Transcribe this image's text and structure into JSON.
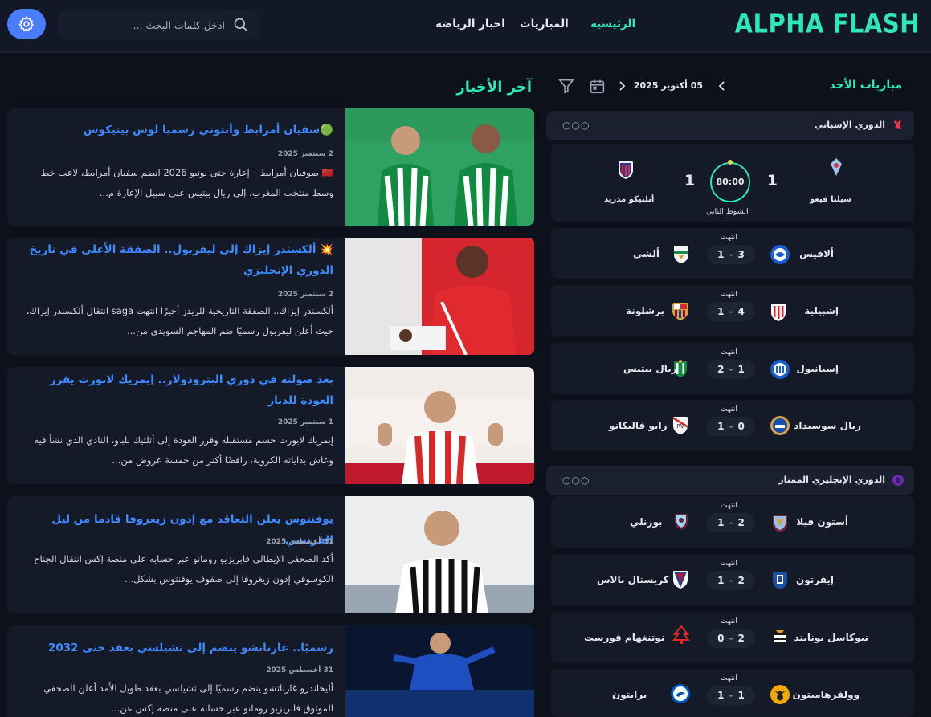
{
  "brand": {
    "logo_text": "ALPHA FLASH",
    "accent": "#2ee6b6",
    "link": "#3e8bff"
  },
  "nav": {
    "items": [
      {
        "label": "الرئيسية",
        "active": true
      },
      {
        "label": "المباريات",
        "active": false
      },
      {
        "label": "اخبار الرياضة",
        "active": false
      }
    ]
  },
  "search": {
    "placeholder": "ادخل كلمات البحث ..."
  },
  "icons": {
    "search": "search-icon",
    "settings": "gear-icon",
    "calendar": "calendar-icon",
    "filter": "filter-icon"
  },
  "matches": {
    "title": "مباريات الأحد",
    "date": "05 أكتوبر 2025",
    "leagues": [
      {
        "name": "الدوري الإسباني",
        "featured": {
          "home": "سيلتا فيغو",
          "away": "أتلتيكو مدريد",
          "home_score": "1",
          "away_score": "1",
          "clock": "80:00",
          "period": "الشوط الثاني"
        },
        "matches": [
          {
            "home": "ألافيس",
            "away": "ألشي",
            "home_score": "3",
            "away_score": "1",
            "status": "انتهت"
          },
          {
            "home": "إشبيلية",
            "away": "برشلونة",
            "home_score": "4",
            "away_score": "1",
            "status": "انتهت"
          },
          {
            "home": "إسبانيول",
            "away": "ريال بيتيس",
            "home_score": "1",
            "away_score": "2",
            "status": "انتهت"
          },
          {
            "home": "ريال سوسيداد",
            "away": "رايو فاليكانو",
            "home_score": "0",
            "away_score": "1",
            "status": "انتهت"
          }
        ]
      },
      {
        "name": "الدوري الإنجليزي الممتاز",
        "matches": [
          {
            "home": "أستون فيلا",
            "away": "بورنلي",
            "home_score": "2",
            "away_score": "1",
            "status": "انتهت"
          },
          {
            "home": "إيفرتون",
            "away": "كريستال بالاس",
            "home_score": "2",
            "away_score": "1",
            "status": "انتهت"
          },
          {
            "home": "نيوكاسل يونايتد",
            "away": "نوتنغهام فورست",
            "home_score": "2",
            "away_score": "0",
            "status": "انتهت"
          },
          {
            "home": "وولفرهامبتون",
            "away": "برايتون",
            "home_score": "1",
            "away_score": "1",
            "status": "انتهت"
          }
        ]
      }
    ]
  },
  "news": {
    "title": "آخر الأخبار",
    "items": [
      {
        "headline": "🟢سفيان أمرابط وأنتوني رسميا لوس بيتيكوس",
        "date": "2 سبتمبر 2025",
        "body": "🇲🇦 صوفيان أمرابط – إعارة حتى يونيو 2026 انضم سفيان أمرابط، لاعب خط وسط منتخب المغرب، إلى ريال بيتيس على سبيل الإعارة م..."
      },
      {
        "headline": "💥 ألكسندر إيزاك إلى ليفربول.. الصفقة الأغلى في تاريخ الدوري الإنجليزي",
        "date": "2 سبتمبر 2025",
        "body": "ألكسندر إيزاك.. الصفقة التاريخية للريدز أخيرًا انتهت saga انتقال ألكسندر إيزاك، حيث أعلن ليفربول رسميًا ضم المهاجم السويدي من..."
      },
      {
        "headline": "بعد صولته في دوري البترودولار.. إيمريك لابورت يقرر العودة للديار",
        "date": "1 سبتمبر 2025",
        "body": "إيمريك لابورت حسم مستقبله وقرر العودة إلى أتلتيك بلباو، النادي الذي نشأ فيه وعاش بداياته الكروية، رافضًا أكثر من خمسة عروض من..."
      },
      {
        "headline": "يوفنتوس يعلن التعاقد مع إدون زيغروفا قادما من ليل الفرنسي",
        "date": "31 أغسطس 2025",
        "body": "أكد الصحفي الإيطالي فابريزيو رومانو عبر حسابه على منصة إكس انتقال الجناح الكوسوفي إدون زيغروفا إلى صفوف يوفنتوس بشكل..."
      },
      {
        "headline": "رسميًا.. غارناتشو ينضم إلى تشيلسي بعقد حتى 2032",
        "date": "31 أغسطس 2025",
        "body": "أليخاندرو غارناتشو ينضم رسميًا إلى تشيلسي بعقد طويل الأمد أعلن الصحفي الموثوق فابريزيو رومانو عبر حسابه على منصة إكس عن..."
      }
    ]
  }
}
